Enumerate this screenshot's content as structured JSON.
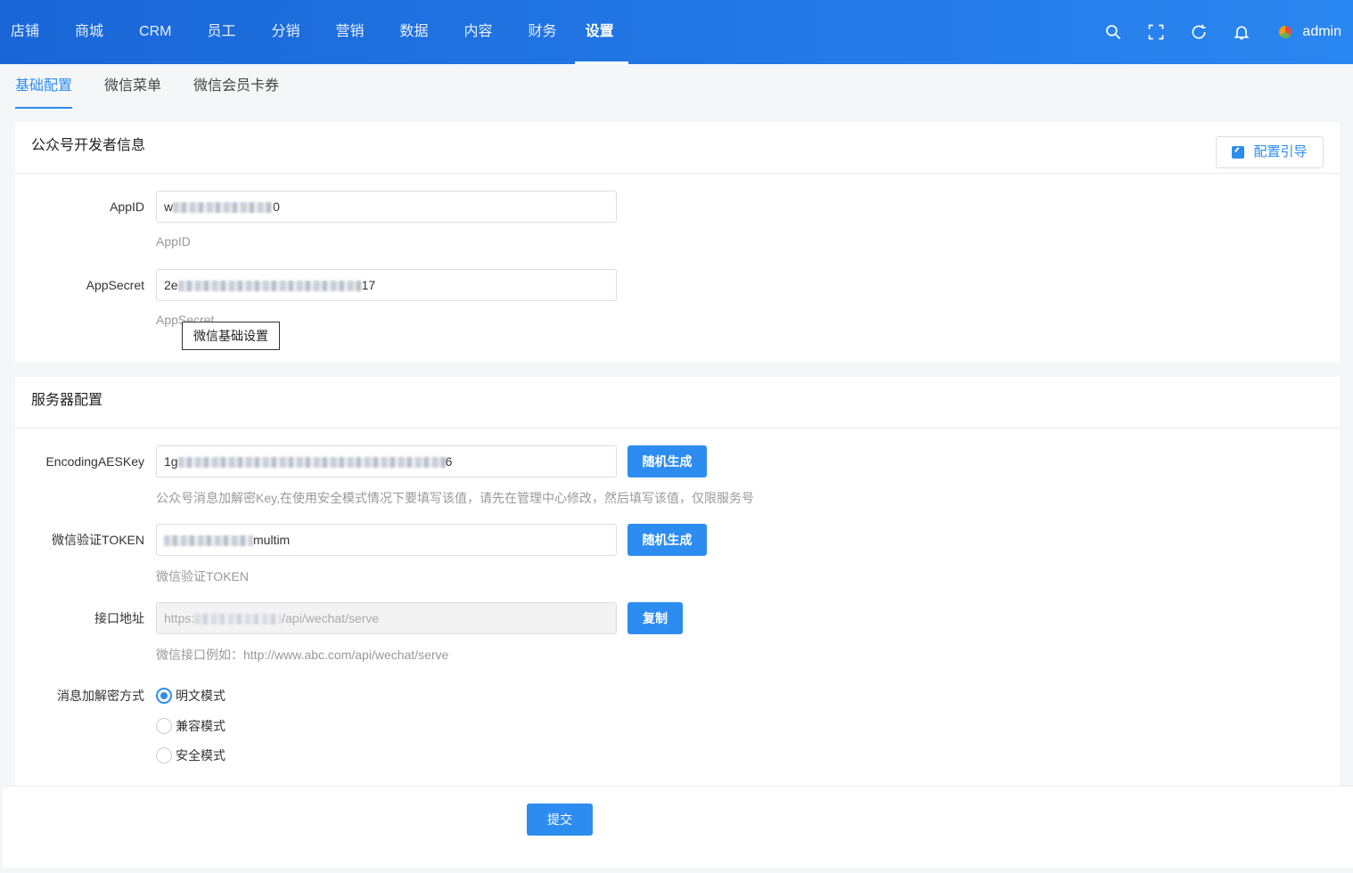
{
  "nav": {
    "items": [
      "店铺",
      "商城",
      "CRM",
      "员工",
      "分销",
      "营销",
      "数据",
      "内容",
      "财务",
      "设置"
    ],
    "active_index": 9,
    "username": "admin"
  },
  "subtabs": [
    "基础配置",
    "微信菜单",
    "微信会员卡券"
  ],
  "dev_info": {
    "title": "公众号开发者信息",
    "guide_label": "配置引导",
    "appid_label": "AppID",
    "appid_prefix": "w",
    "appid_suffix": "0",
    "appid_hint": "AppID",
    "appsecret_label": "AppSecret",
    "appsecret_prefix": "2e",
    "appsecret_suffix": "17",
    "appsecret_hint": "AppSecret",
    "tooltip": "微信基础设置"
  },
  "server": {
    "title": "服务器配置",
    "aeskey_label": "EncodingAESKey",
    "aeskey_prefix": "1g",
    "aeskey_suffix": "6",
    "random_label": "随机生成",
    "aeskey_hint": "公众号消息加解密Key,在使用安全模式情况下要填写该值，请先在管理中心修改，然后填写该值，仅限服务号",
    "token_label": "微信验证TOKEN",
    "token_suffix": "multim",
    "token_hint": "微信验证TOKEN",
    "url_label": "接口地址",
    "url_prefix": "https:",
    "url_suffix": "/api/wechat/serve",
    "copy_label": "复制",
    "url_hint": "微信接口例如：http://www.abc.com/api/wechat/serve",
    "encrypt_label": "消息加解密方式",
    "encrypt_options": [
      "明文模式",
      "兼容模式",
      "安全模式"
    ],
    "encrypt_selected": "明文模式"
  },
  "submit_label": "提交"
}
